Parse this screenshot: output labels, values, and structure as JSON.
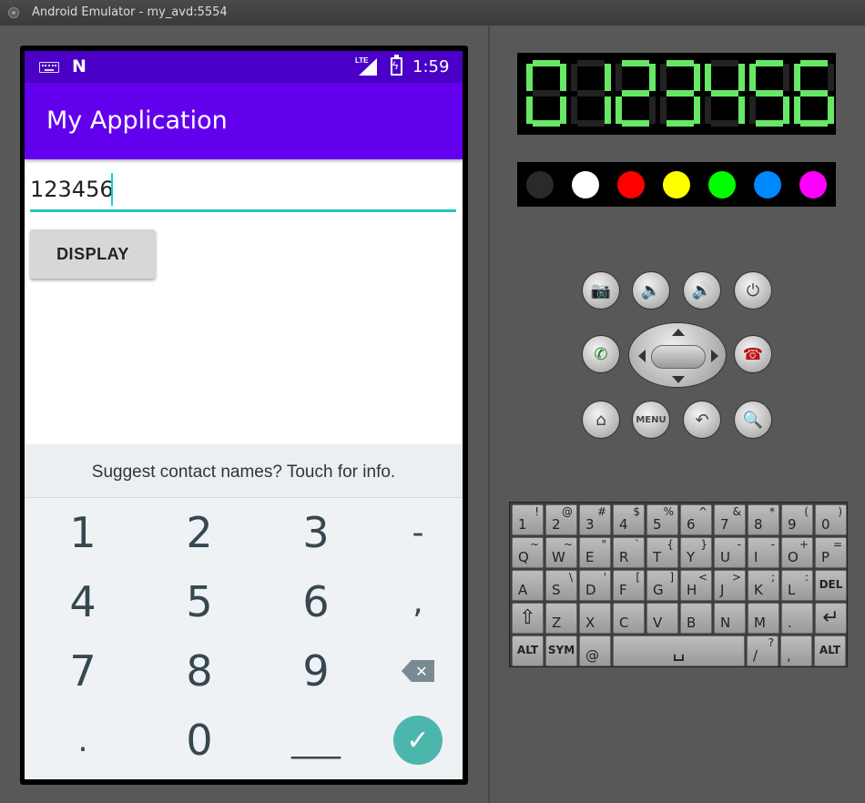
{
  "window": {
    "title": "Android Emulator - my_avd:5554"
  },
  "status_bar": {
    "time": "1:59",
    "network": "LTE"
  },
  "app": {
    "title": "My Application",
    "input_value": "123456",
    "display_button": "DISPLAY"
  },
  "keyboard": {
    "suggestion": "Suggest contact names? Touch for info.",
    "keys": [
      [
        "1",
        "2",
        "3",
        "-"
      ],
      [
        "4",
        "5",
        "6",
        ","
      ],
      [
        "7",
        "8",
        "9",
        "⌫"
      ],
      [
        ".",
        "0",
        "___",
        "✓"
      ]
    ]
  },
  "emulator_panel": {
    "led_digits": "0123456",
    "color_dots": [
      "#2a2a2a",
      "#ffffff",
      "#ff0000",
      "#ffff00",
      "#00ff00",
      "#0088ff",
      "#ff00ff"
    ],
    "buttons": {
      "row1": [
        "camera-icon",
        "volume-down-icon",
        "volume-up-icon",
        "power-icon"
      ],
      "row2": [
        "call-icon",
        "dpad",
        "end-call-icon"
      ],
      "row3": [
        "home-icon",
        "MENU",
        "back-icon",
        "search-icon"
      ]
    },
    "qwerty_rows": [
      [
        [
          "1",
          "!"
        ],
        [
          "2",
          "@"
        ],
        [
          "3",
          "#"
        ],
        [
          "4",
          "$"
        ],
        [
          "5",
          "%"
        ],
        [
          "6",
          "^"
        ],
        [
          "7",
          "&"
        ],
        [
          "8",
          "*"
        ],
        [
          "9",
          "("
        ],
        [
          "0",
          ")"
        ]
      ],
      [
        [
          "Q",
          "~"
        ],
        [
          "W",
          "~"
        ],
        [
          "E",
          "\""
        ],
        [
          "R",
          "`"
        ],
        [
          "T",
          "{"
        ],
        [
          "Y",
          "}"
        ],
        [
          "U",
          "-"
        ],
        [
          "I",
          "-"
        ],
        [
          "O",
          "+"
        ],
        [
          "P",
          "="
        ]
      ],
      [
        [
          "A",
          ""
        ],
        [
          "S",
          "\\"
        ],
        [
          "D",
          "'"
        ],
        [
          "F",
          "["
        ],
        [
          "G",
          "]"
        ],
        [
          "H",
          "<"
        ],
        [
          "J",
          ">"
        ],
        [
          "K",
          ";"
        ],
        [
          "L",
          ":"
        ],
        [
          "DEL",
          ""
        ]
      ],
      [
        [
          "⇧",
          ""
        ],
        [
          "Z",
          ""
        ],
        [
          "X",
          ""
        ],
        [
          "C",
          ""
        ],
        [
          "V",
          ""
        ],
        [
          "B",
          ""
        ],
        [
          "N",
          ""
        ],
        [
          "M",
          ""
        ],
        [
          ".",
          ""
        ],
        [
          "↵",
          ""
        ]
      ],
      [
        [
          "ALT",
          ""
        ],
        [
          "SYM",
          ""
        ],
        [
          "@",
          ""
        ],
        [
          "SPACE",
          ""
        ],
        [
          "/",
          "?"
        ],
        [
          ",",
          ""
        ],
        [
          "ALT",
          ""
        ]
      ]
    ]
  }
}
